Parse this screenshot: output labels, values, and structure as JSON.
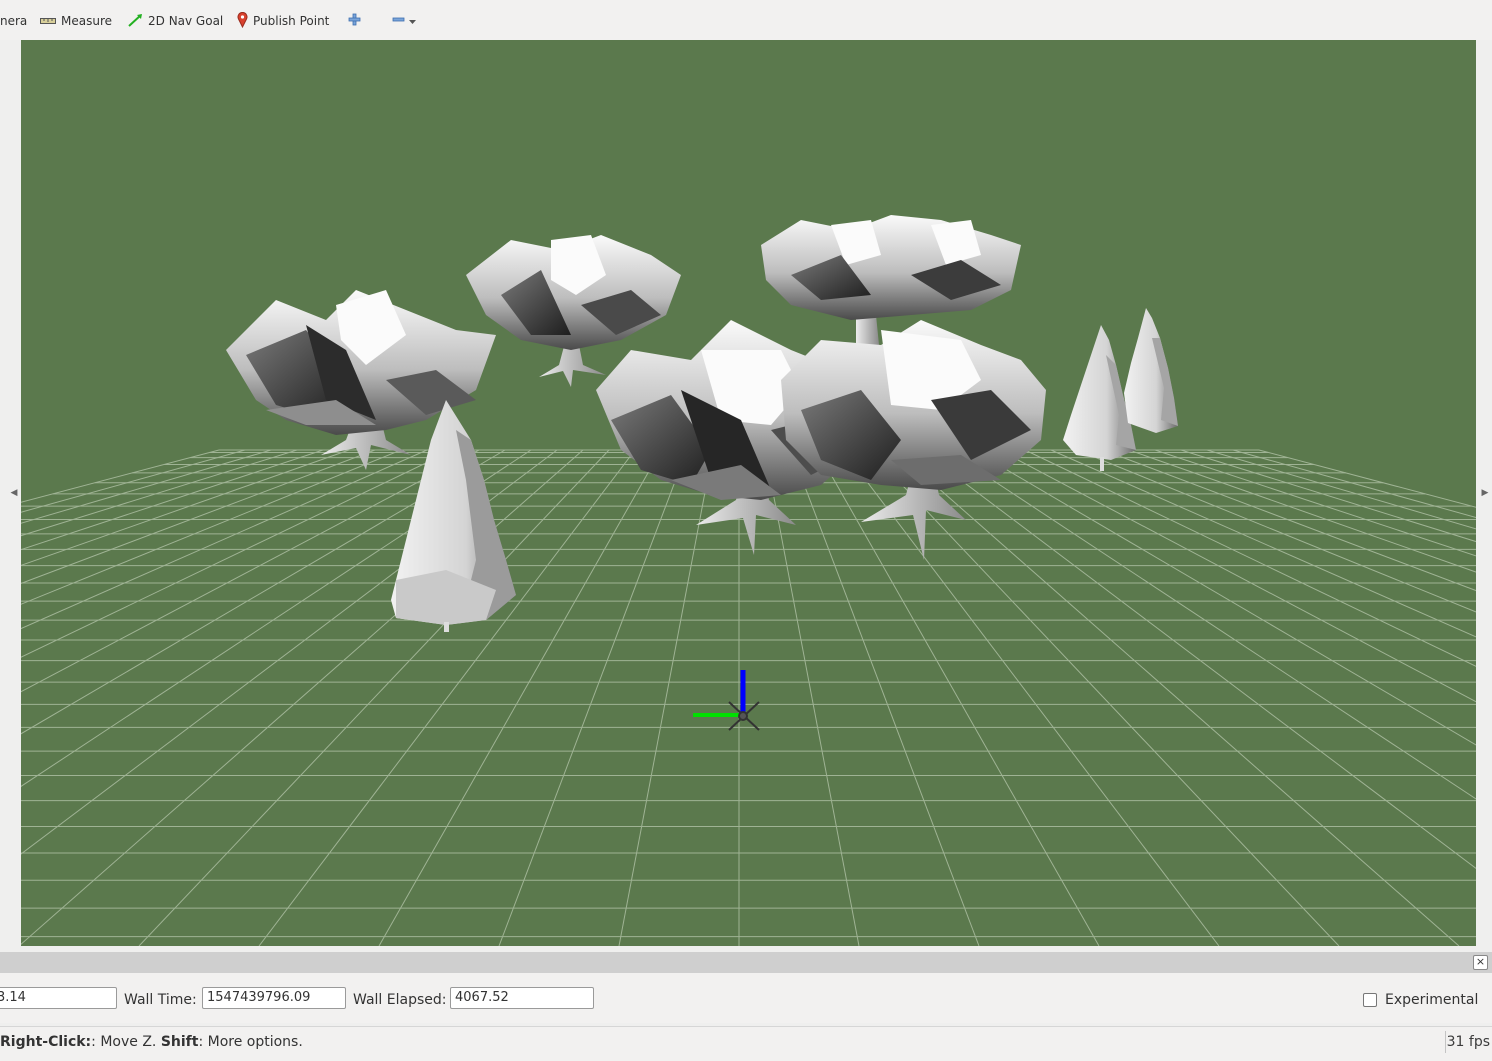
{
  "toolbar": {
    "camera_label": "nera",
    "measure_label": "Measure",
    "nav_goal_label": "2D Nav Goal",
    "publish_point_label": "Publish Point"
  },
  "time_panel": {
    "ros_time_partial": "3.14",
    "wall_time_label": "Wall Time:",
    "wall_time_value": "1547439796.09",
    "wall_elapsed_label": "Wall Elapsed:",
    "wall_elapsed_value": "4067.52",
    "experimental_label": "Experimental",
    "experimental_checked": false
  },
  "status_bar": {
    "hint_bold_1": "Right-Click:",
    "hint_text_1": ": Move Z. ",
    "hint_bold_2": "Shift",
    "hint_text_2": ": More options.",
    "fps": "31 fps"
  },
  "colors": {
    "viewport_bg": "#5b794d",
    "grid": "#9fb394",
    "axis_x": "#00e000",
    "axis_z": "#0000ff"
  }
}
